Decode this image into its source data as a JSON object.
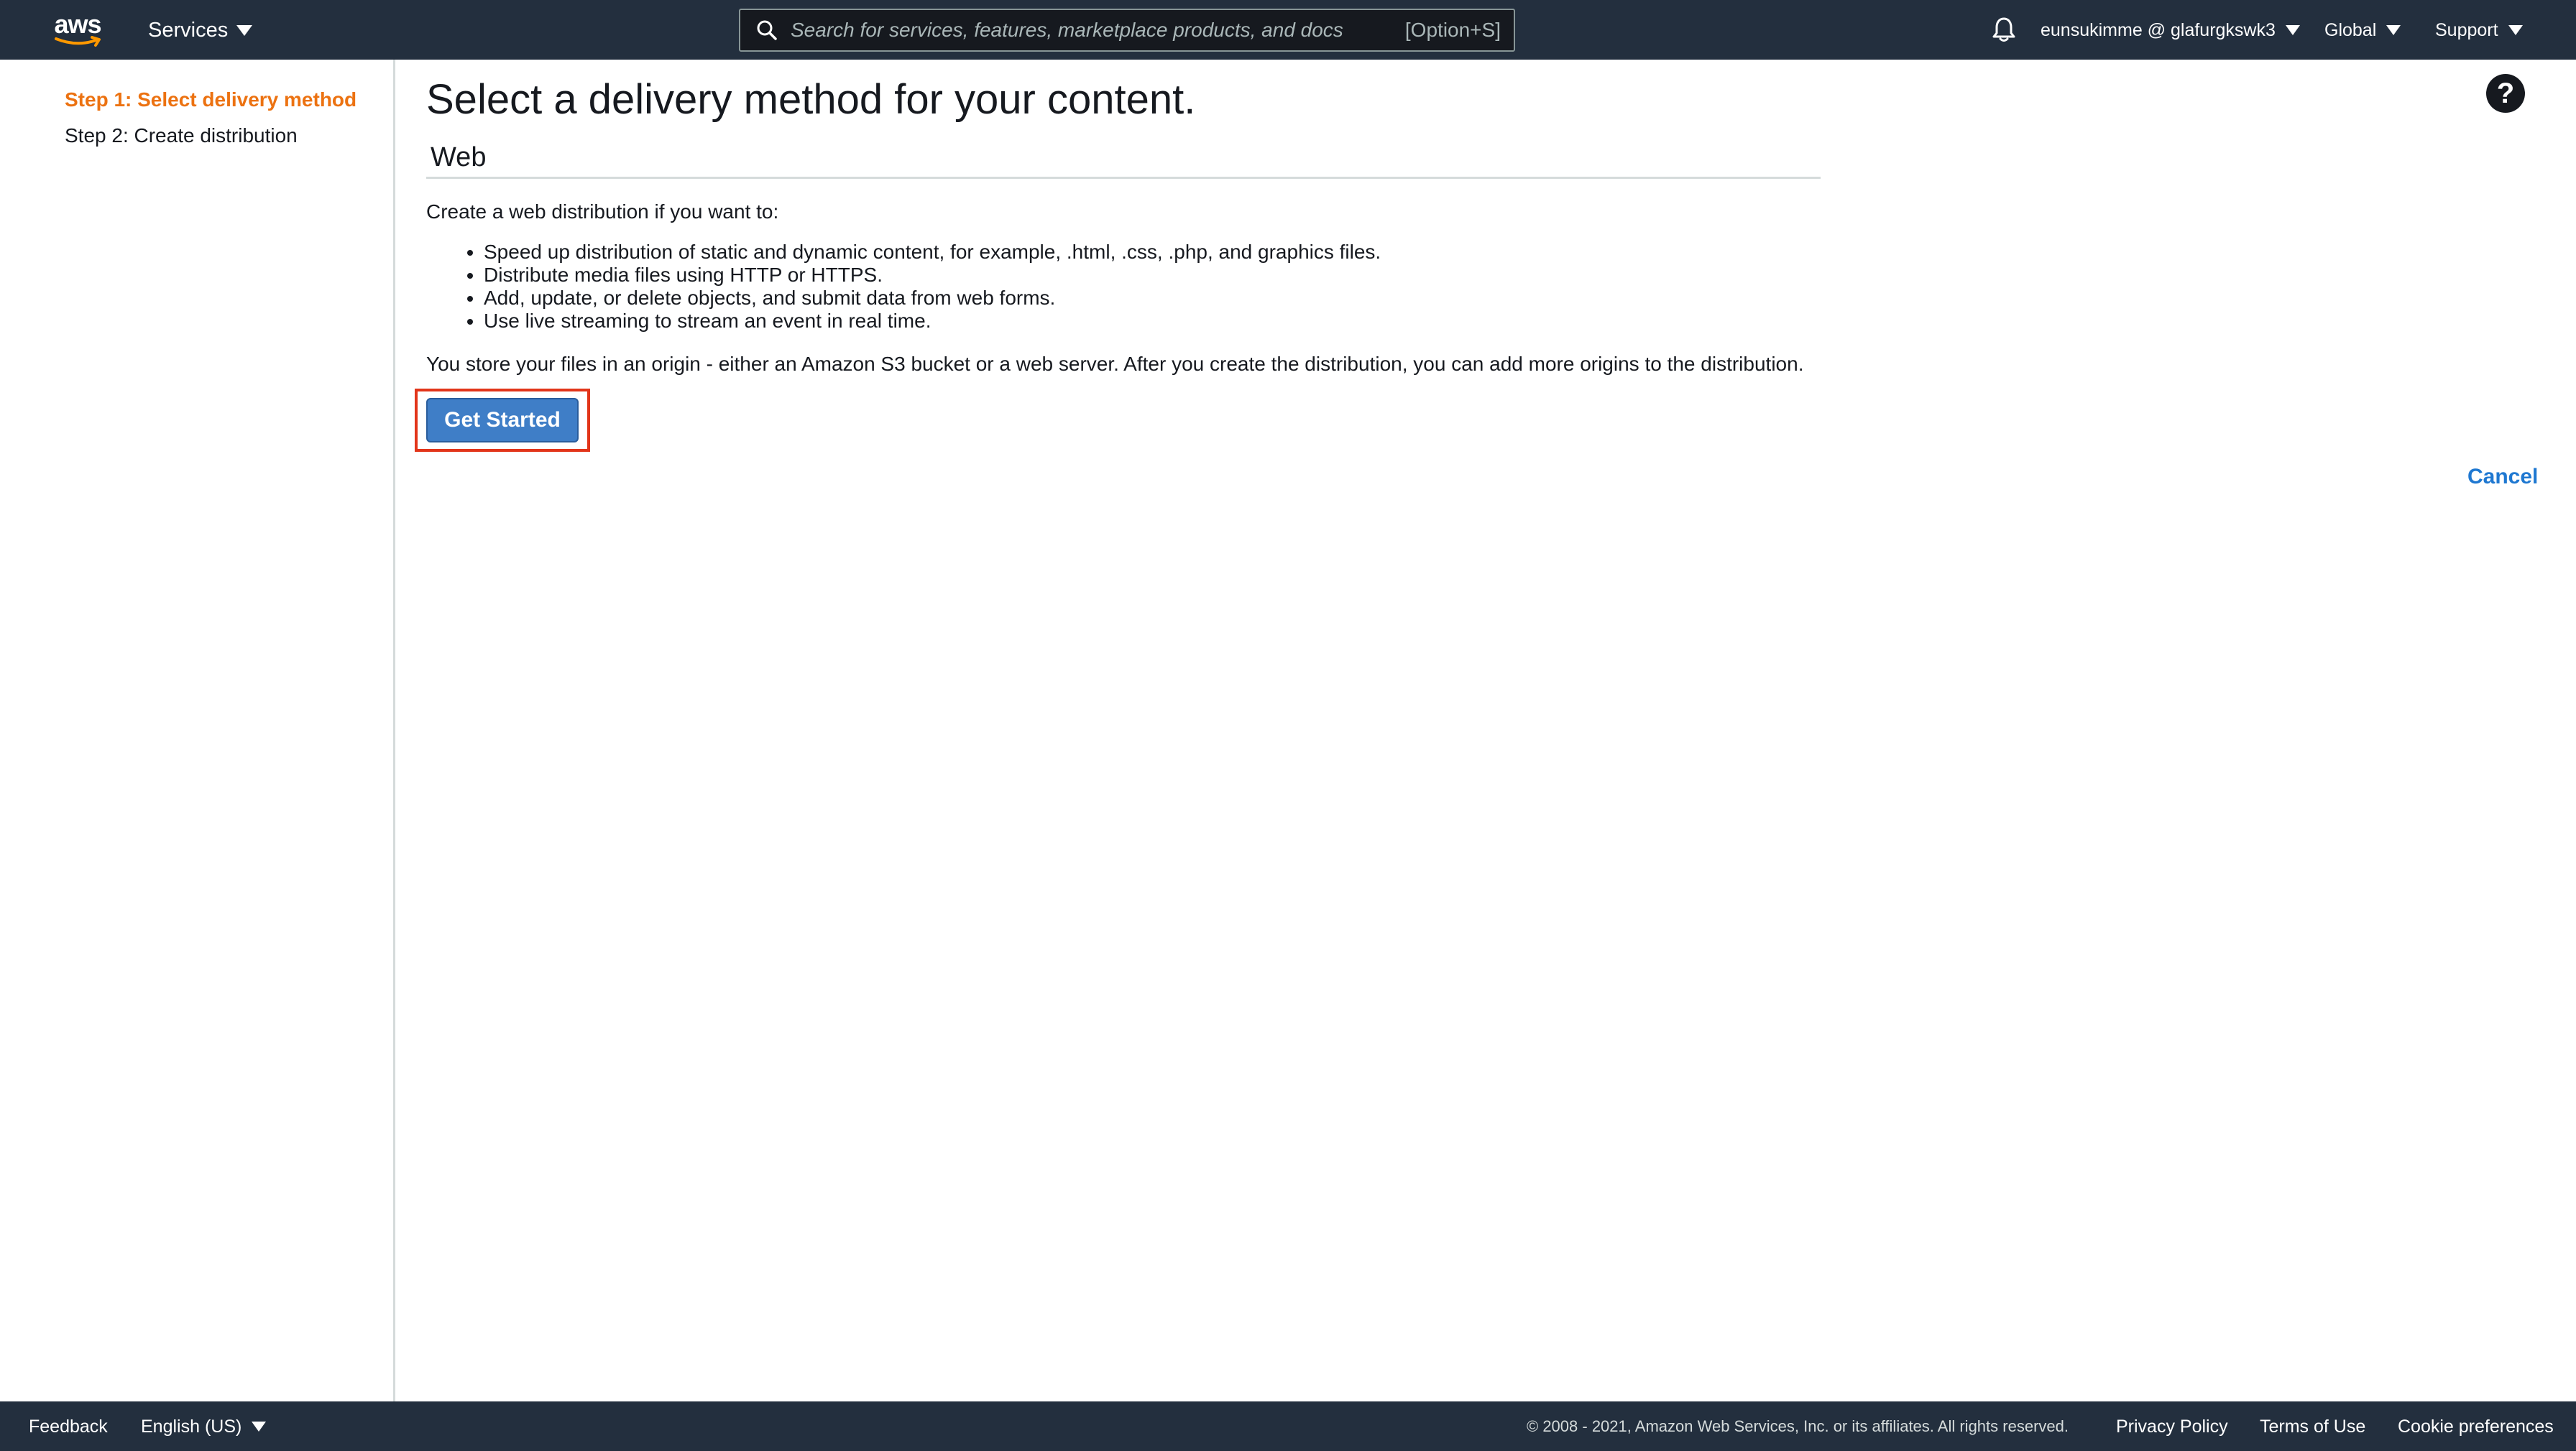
{
  "nav": {
    "logo_text": "aws",
    "services_label": "Services",
    "search_placeholder": "Search for services, features, marketplace products, and docs",
    "search_shortcut": "[Option+S]",
    "account_label": "eunsukimme @ glafurgkswk3",
    "region_label": "Global",
    "support_label": "Support"
  },
  "sidebar": {
    "steps": [
      {
        "label": "Step 1: Select delivery method",
        "active": true
      },
      {
        "label": "Step 2: Create distribution",
        "active": false
      }
    ]
  },
  "main": {
    "title": "Select a delivery method for your content.",
    "help_icon_glyph": "?",
    "section_title": "Web",
    "intro": "Create a web distribution if you want to:",
    "bullets": [
      "Speed up distribution of static and dynamic content, for example, .html, .css, .php, and graphics files.",
      "Distribute media files using HTTP or HTTPS.",
      "Add, update, or delete objects, and submit data from web forms.",
      "Use live streaming to stream an event in real time."
    ],
    "origin_text": "You store your files in an origin - either an Amazon S3 bucket or a web server. After you create the distribution, you can add more origins to the distribution.",
    "get_started_label": "Get Started",
    "cancel_label": "Cancel"
  },
  "footer": {
    "feedback_label": "Feedback",
    "language_label": "English (US)",
    "copyright": "© 2008 - 2021, Amazon Web Services, Inc. or its affiliates. All rights reserved.",
    "privacy_label": "Privacy Policy",
    "terms_label": "Terms of Use",
    "cookie_label": "Cookie preferences"
  },
  "colors": {
    "nav_bg": "#232f3e",
    "active_step": "#ec7211",
    "primary_button": "#3f7ec7",
    "link": "#1f78d1",
    "highlight": "#e2351a"
  },
  "icons": [
    "aws-logo",
    "search-icon",
    "bell-icon",
    "help-icon",
    "caret-down-icon"
  ]
}
